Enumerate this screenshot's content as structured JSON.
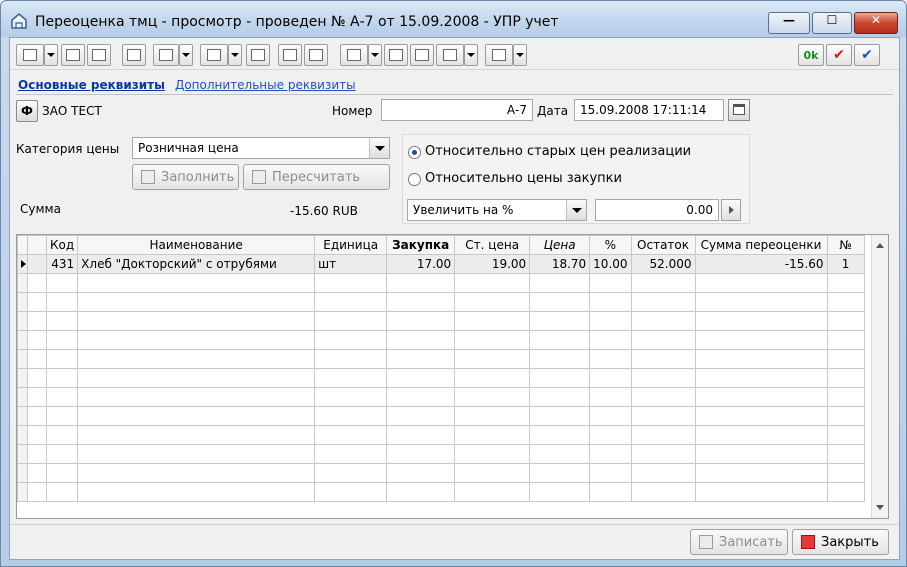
{
  "window": {
    "title": "Переоценка тмц - просмотр - проведен № А-7 от 15.09.2008 - УПР учет",
    "minimize": "—",
    "maximize": "☐",
    "close": "✕"
  },
  "toolbar": {
    "ok_label": "0k",
    "check_red": "✔",
    "check_blue": "✔"
  },
  "tabs": {
    "main": "Основные реквизиты",
    "extra": "Дополнительные реквизиты"
  },
  "org": {
    "button_glyph": "Ф",
    "name": "ЗАО ТЕСТ"
  },
  "number": {
    "label": "Номер",
    "value": "А-7"
  },
  "date": {
    "label": "Дата",
    "value": "15.09.2008 17:11:14"
  },
  "price_category": {
    "label": "Категория цены",
    "value": "Розничная цена"
  },
  "buttons": {
    "fill": "Заполнить",
    "recalc": "Пересчитать",
    "save": "Записать",
    "close": "Закрыть"
  },
  "sum": {
    "label": "Сумма",
    "value": "-15.60 RUB"
  },
  "options": {
    "radio_old": "Относительно старых цен реализации",
    "radio_purchase": "Относительно цены закупки",
    "mode": "Увеличить на %",
    "amount": "0.00"
  },
  "table": {
    "headers": [
      "Код",
      "Наименование",
      "Единица",
      "Закупка",
      "Ст. цена",
      "Цена",
      "%",
      "Остаток",
      "Сумма переоценки",
      "№"
    ],
    "rows": [
      [
        "431",
        "Хлеб \"Докторский\" с отрубями",
        "шт",
        "17.00",
        "19.00",
        "18.70",
        "10.00",
        "52.000",
        "-15.60",
        "1"
      ]
    ]
  }
}
